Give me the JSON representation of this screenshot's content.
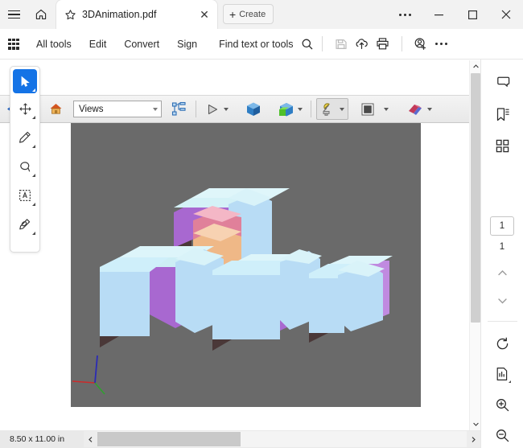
{
  "window": {
    "menu_icon": "hamburger-icon",
    "home_icon": "home-icon",
    "more_icon": "more-options-icon",
    "minimize_label": "─",
    "maximize_label": "□",
    "close_label": "✕"
  },
  "tab": {
    "star_icon": "star-icon",
    "title": "3DAnimation.pdf",
    "close_label": "✕",
    "create_plus": "+",
    "create_label": "Create"
  },
  "menubar": {
    "all_tools_icon": "app-grid-icon",
    "items": [
      {
        "label": "All tools"
      },
      {
        "label": "Edit"
      },
      {
        "label": "Convert"
      },
      {
        "label": "Sign"
      }
    ],
    "find_label": "Find text or tools",
    "find_icon": "search-icon",
    "save_icon": "save-icon",
    "upload_icon": "cloud-upload-icon",
    "print_icon": "print-icon",
    "share_icon": "add-person-icon",
    "overflow_icon": "more-options-icon"
  },
  "left_tools": [
    {
      "name": "select-tool",
      "icon": "cursor-arrow-icon",
      "active": true
    },
    {
      "name": "pan-tool",
      "icon": "move-arrows-icon",
      "active": false
    },
    {
      "name": "comment-pencil-tool",
      "icon": "pencil-icon",
      "active": false
    },
    {
      "name": "lasso-tool",
      "icon": "lasso-icon",
      "active": false
    },
    {
      "name": "text-select-tool",
      "icon": "text-box-icon",
      "active": false
    },
    {
      "name": "redact-tool",
      "icon": "redact-icon",
      "active": false
    }
  ],
  "toolbar3d": {
    "rotate_icon": "rotate-3d-icon",
    "home_icon": "default-view-home-icon",
    "views_value": "Views",
    "views_placeholder": "Views",
    "model_tree_icon": "model-tree-icon",
    "play_icon": "play-animation-icon",
    "render_mode_icon": "render-mode-cube-icon",
    "extra_render_icon": "cross-section-cube-icon",
    "lighting_icon": "lighting-lamp-icon",
    "background_color_icon": "background-color-icon",
    "cross_section_icon": "cross-section-icon"
  },
  "canvas": {
    "background_color": "#6a6a6a",
    "axis_x_color": "#cc2b2b",
    "axis_y_color": "#2fa02f",
    "axis_z_color": "#2b2bb5",
    "cube_front_color": "#b8dcf5",
    "cube_top_color": "#d4f2f7",
    "cube_purple_color": "#a868d0",
    "cube_shadow_color": "#4a3838",
    "cube_orange_color": "#efb887",
    "cube_pink_color": "#e0809a"
  },
  "status": {
    "page_size": "8.50 x 11.00 in",
    "scroll_left_icon": "chevron-left-icon",
    "scroll_right_icon": "chevron-right-icon"
  },
  "right_rail": {
    "comment_icon": "comment-icon",
    "bookmark_icon": "bookmark-icon",
    "thumbnails_icon": "page-thumbnails-icon",
    "current_page": "1",
    "total_pages": "1",
    "prev_page_icon": "chevron-up-icon",
    "next_page_icon": "chevron-down-icon",
    "rotate_icon": "rotate-page-icon",
    "fit_page_icon": "fit-page-icon",
    "zoom_in_icon": "zoom-in-icon",
    "zoom_out_icon": "zoom-out-icon"
  }
}
